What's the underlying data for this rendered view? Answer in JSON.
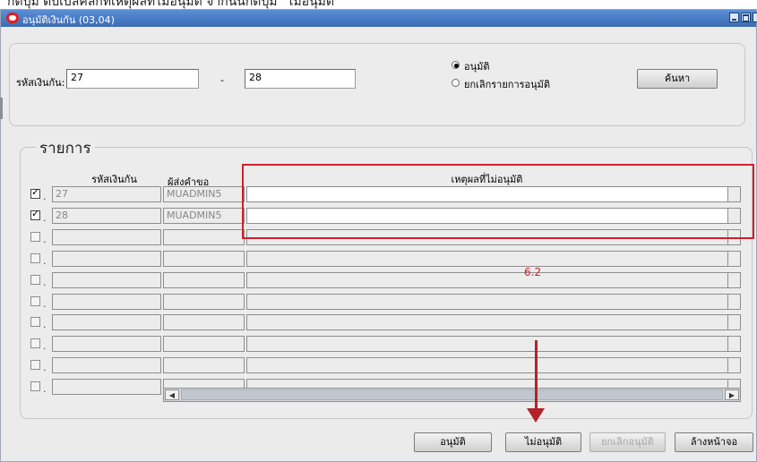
{
  "caption": "กดปุ่ม ดับเบิลคลิกที่เหตุผลที่ไม่อนุมัติ จากนั้นกดปุ่ม \"ไม่อนุมัติ\"",
  "window": {
    "title": "อนุมัติเงินกัน (03,04)"
  },
  "criteria": {
    "code_label": "รหัสเงินกัน:",
    "code_from": "27",
    "separator": "-",
    "code_to": "28",
    "radio_approve": "อนุมัติ",
    "radio_cancel": "ยกเลิกรายการอนุมัติ",
    "search_button": "ค้นหา"
  },
  "list": {
    "section_title": "รายการ",
    "headers": {
      "code": "รหัสเงินกัน",
      "requester": "ผู้ส่งคำขอ",
      "reason": "เหตุผลที่ไม่อนุมัติ"
    },
    "rows": [
      {
        "checked": true,
        "code": "27",
        "requester": "MUADMIN5",
        "reason": ""
      },
      {
        "checked": true,
        "code": "28",
        "requester": "MUADMIN5",
        "reason": ""
      },
      {
        "checked": false,
        "code": "",
        "requester": "",
        "reason": ""
      },
      {
        "checked": false,
        "code": "",
        "requester": "",
        "reason": ""
      },
      {
        "checked": false,
        "code": "",
        "requester": "",
        "reason": ""
      },
      {
        "checked": false,
        "code": "",
        "requester": "",
        "reason": ""
      },
      {
        "checked": false,
        "code": "",
        "requester": "",
        "reason": ""
      },
      {
        "checked": false,
        "code": "",
        "requester": "",
        "reason": ""
      },
      {
        "checked": false,
        "code": "",
        "requester": "",
        "reason": ""
      },
      {
        "checked": false,
        "code": "",
        "requester": "",
        "reason": ""
      }
    ]
  },
  "annotation": {
    "step": "6.2",
    "color": "#d0202a"
  },
  "buttons": {
    "approve": "อนุมัติ",
    "reject": "ไม่อนุมัติ",
    "cancel_approve": "ยกเลิกอนุมัติ",
    "clear": "ล้างหน้าจอ"
  }
}
